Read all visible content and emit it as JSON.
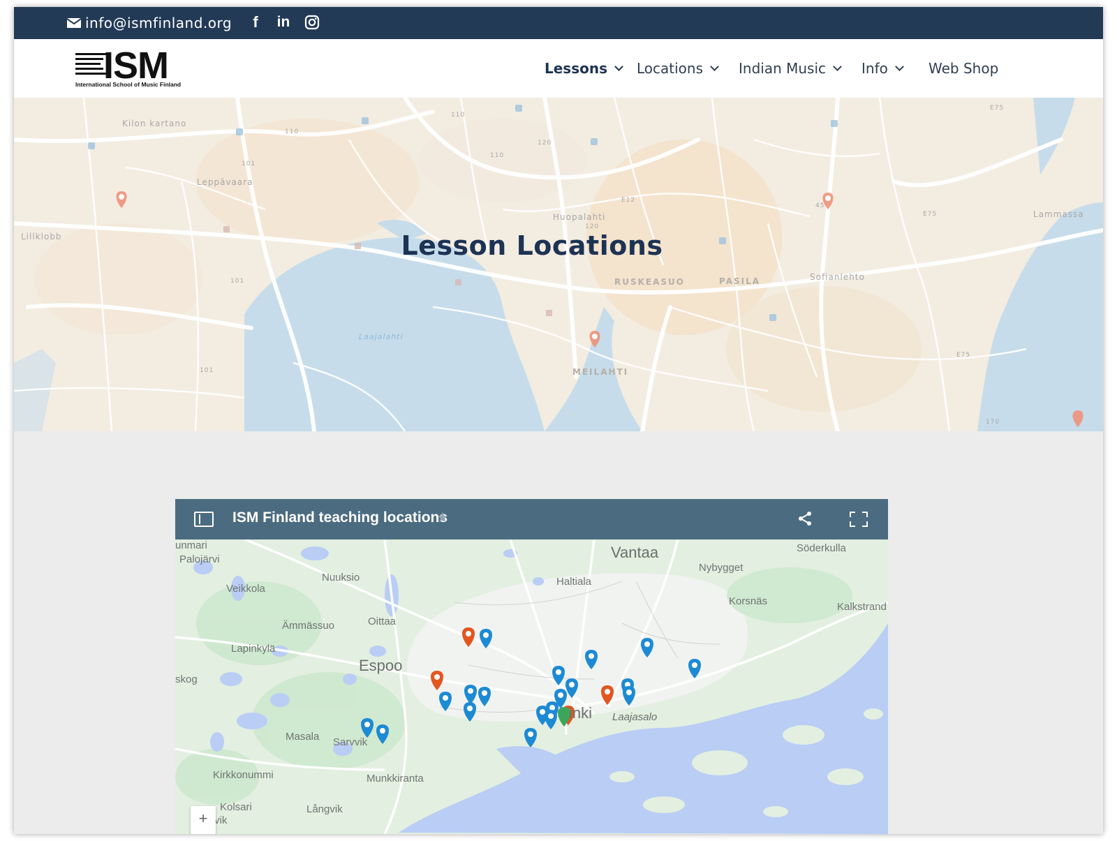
{
  "topbar": {
    "email": "info@ismfinland.org",
    "social": [
      {
        "name": "facebook-icon",
        "glyph": "f"
      },
      {
        "name": "linkedin-icon",
        "glyph": "in"
      },
      {
        "name": "instagram-icon",
        "glyph": ""
      }
    ]
  },
  "header": {
    "logo_word": "ISM",
    "logo_tagline": "International School of Music Finland",
    "nav": [
      {
        "label": "Lessons",
        "dropdown": true,
        "active": true
      },
      {
        "label": "Locations",
        "dropdown": true,
        "active": false
      },
      {
        "label": "Indian Music",
        "dropdown": true,
        "active": false
      },
      {
        "label": "Info",
        "dropdown": true,
        "active": false
      },
      {
        "label": "Web Shop",
        "dropdown": false,
        "active": false
      }
    ]
  },
  "hero": {
    "title": "Lesson Locations",
    "map_labels": {
      "kilon_kartano": "Kilon kartano",
      "leppavaara": "Leppävaara",
      "lillklobb": "Lillklobb",
      "huopalahti": "Huopalahti",
      "ruskeasuo": "RUSKEASUO",
      "pasila": "PASILA",
      "sofianlehto": "Sofianlehto",
      "meilahti": "MEILAHTI",
      "laajalahti": "Laajalahti",
      "lammassaari": "Lammassa"
    },
    "road_numbers": {
      "r110a": "110",
      "r110b": "110",
      "r110c": "110",
      "r120a": "120",
      "r120b": "120",
      "r101a": "101",
      "r101b": "101",
      "r101c": "101",
      "e12": "E12",
      "e75a": "E75",
      "e75b": "E75",
      "e75c": "E75",
      "r170": "170",
      "r45": "45"
    }
  },
  "embed": {
    "title": "ISM Finland teaching locations",
    "zoom_in": "+",
    "place_labels": {
      "vantaa": "Vantaa",
      "espoo": "Espoo",
      "helsinki": "inki",
      "soderkulla": "Söderkulla",
      "nybygget": "Nybygget",
      "korsnas": "Korsnäs",
      "kalkstrand": "Kalkstrand",
      "haltiala": "Haltiala",
      "nuuksio": "Nuuksio",
      "veikkola": "Veikkola",
      "ammassuo": "Ämmässuo",
      "oittaa": "Oittaa",
      "lapinkyla": "Lapinkylä",
      "skog": "skog",
      "masala": "Masala",
      "sarvvik": "Sarvvik",
      "kirkkonummi": "Kirkkonummi",
      "munkkiranta": "Munkkiranta",
      "kolsari": "Kolsari",
      "langvik": "Långvik",
      "laajasalo": "Laajasalo",
      "palojarvi": "Palojärvi",
      "nunmari": "unmari",
      "vik": "vik"
    },
    "colors": {
      "blue_pin": "#1d8ad4",
      "orange_pin": "#e2561f",
      "water": "#b9cdf5",
      "land": "#e3efe0"
    }
  }
}
